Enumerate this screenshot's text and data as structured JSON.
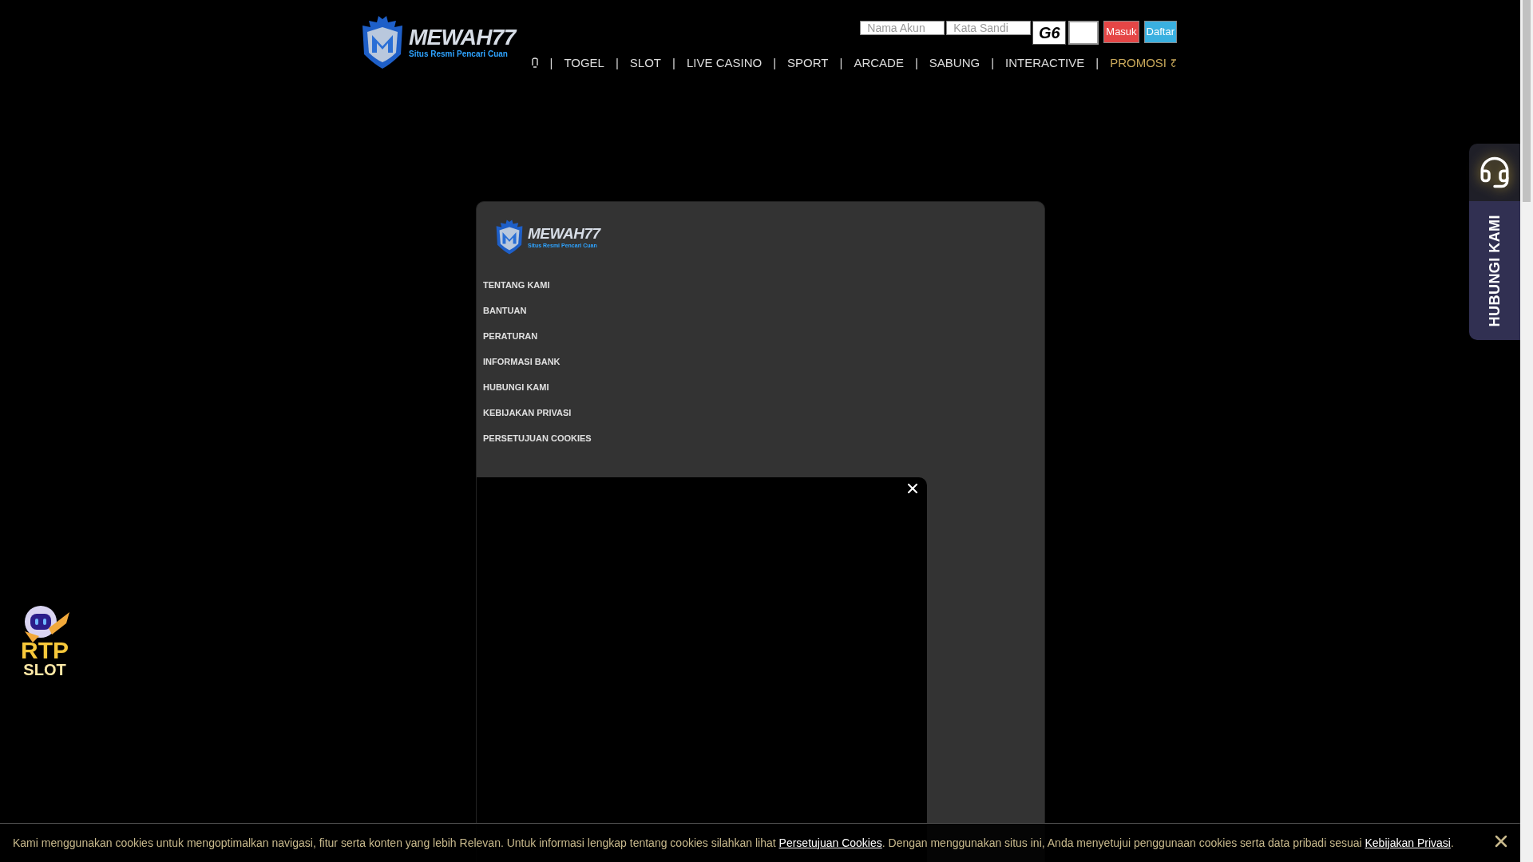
{
  "header": {
    "logo": {
      "name": "MEWAH77",
      "tagline": "Situs Resmi Pencari Cuan"
    },
    "login": {
      "username_placeholder": "Nama Akun",
      "password_placeholder": "Kata Sandi",
      "captcha": "G6",
      "login_button": "Masuk",
      "register_button": "Daftar"
    },
    "nav": [
      {
        "separator": "|",
        "label": "TOGEL",
        "highlight": false
      },
      {
        "separator": "|",
        "label": "SLOT",
        "highlight": false
      },
      {
        "separator": "|",
        "label": "LIVE CASINO",
        "highlight": false
      },
      {
        "separator": "|",
        "label": "SPORT",
        "highlight": false
      },
      {
        "separator": "|",
        "label": "ARCADE",
        "highlight": false
      },
      {
        "separator": "|",
        "label": "SABUNG",
        "highlight": false
      },
      {
        "separator": "|",
        "label": "INTERACTIVE",
        "highlight": false
      },
      {
        "separator": "|",
        "label": "PROMOSI",
        "highlight": true
      }
    ]
  },
  "menu_panel": {
    "logo": {
      "name": "MEWAH77",
      "tagline": "Situs Resmi Pencari Cuan"
    },
    "items": [
      "TENTANG KAMI",
      "BANTUAN",
      "PERATURAN",
      "INFORMASI BANK",
      "HUBUNGI KAMI",
      "KEBIJAKAN PRIVASI",
      "PERSETUJUAN COOKIES"
    ]
  },
  "contact_tab": {
    "label": "HUBUNGI KAMI"
  },
  "rtp_badge": {
    "line1": "RTP",
    "line2": "SLOT"
  },
  "cookie_bar": {
    "parts": [
      {
        "kind": "text",
        "text": "Kami menggunakan cookies untuk mengoptimalkan navigasi, fitur serta konten yang lebih Relevan. Untuk informasi lengkap tentang cookies silahkan lihat "
      },
      {
        "kind": "link",
        "text": "Persetujuan Cookies"
      },
      {
        "kind": "text",
        "text": ". Dengan menggunakan situs ini, Anda menyetujui penggunaan cookies serta data pribadi sesuai "
      },
      {
        "kind": "link",
        "text": "Kebijakan Privasi"
      },
      {
        "kind": "text",
        "text": "."
      }
    ]
  }
}
